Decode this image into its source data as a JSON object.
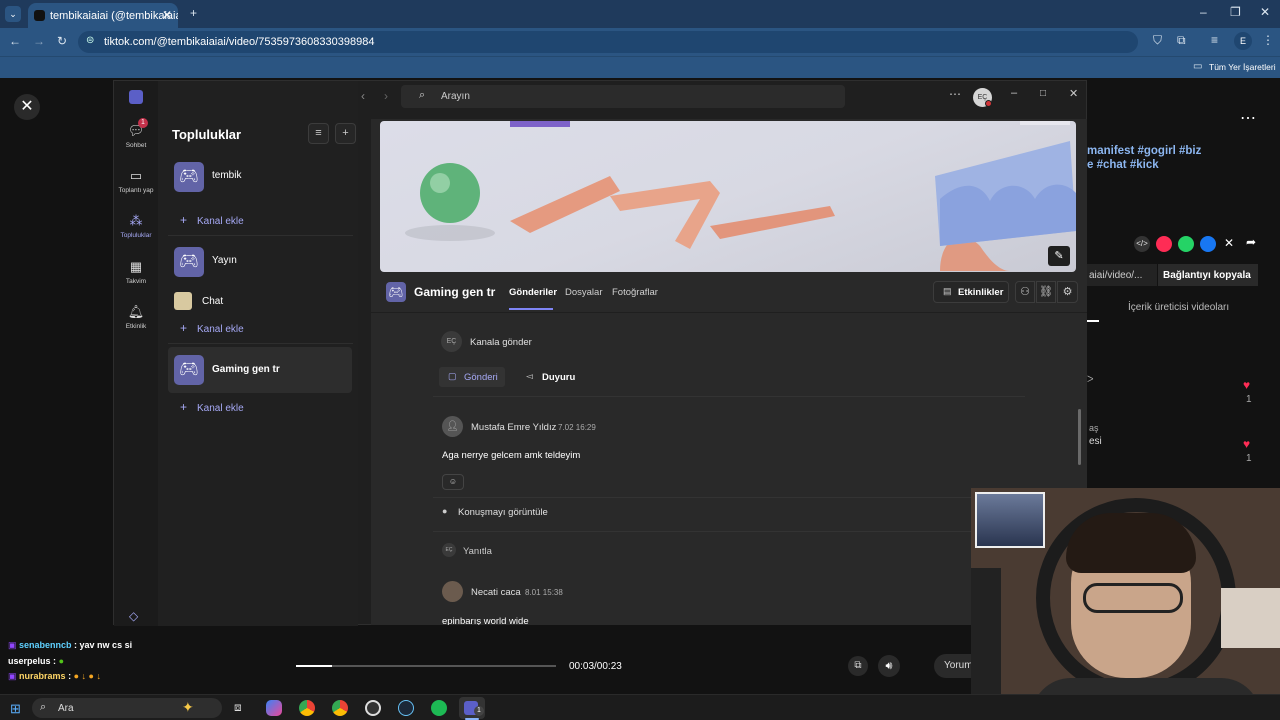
{
  "browser": {
    "tab_title": "tembikaiaiai (@tembikaiaiai) | T",
    "url": "tiktok.com/@tembikaiaiai/video/7535973608330398984",
    "profile_initial": "E",
    "bookmarks_label": "Tüm Yer İşaretleri"
  },
  "tiktok": {
    "hashtags_line1": "manifest #gogirl #biz",
    "hashtags_line2": "e #chat #kick",
    "link_partial": "aiai/video/...",
    "copy_link": "Bağlantıyı kopyala",
    "creator_videos": "İçerik üreticisi videoları",
    "comment_partial1": "aş",
    "comment_partial2": "esi",
    "like_count1": "1",
    "like_count2": "1",
    "time_display": "00:03/00:23",
    "progress": 0.14,
    "comment_button": "Yorum"
  },
  "stream_chat": [
    {
      "user": "senabenncb",
      "text": ": yav nw cs si"
    },
    {
      "user": "userpelus",
      "text": ":"
    },
    {
      "user": "nurabrams",
      "text": ":"
    }
  ],
  "taskbar": {
    "search_placeholder": "Ara",
    "teams_badge": "1"
  },
  "teams": {
    "search_placeholder": "Arayın",
    "avatar_initials": "EÇ",
    "rail": [
      {
        "label": "Sohbet",
        "badge": "1"
      },
      {
        "label": "Toplantı yap"
      },
      {
        "label": "Topluluklar"
      },
      {
        "label": "Takvim"
      },
      {
        "label": "Etkinlik"
      }
    ],
    "sidepane_title": "Topluluklar",
    "communities": [
      {
        "name": "tembik"
      },
      {
        "name": "Yayın"
      },
      {
        "name": "Chat"
      },
      {
        "name": "Gaming gen tr"
      }
    ],
    "add_channel": "Kanal ekle",
    "channel": {
      "name": "Gaming gen tr",
      "tabs": [
        "Gönderiler",
        "Dosyalar",
        "Fotoğraflar"
      ],
      "events_button": "Etkinlikler"
    },
    "compose": {
      "initials": "EÇ",
      "post_to_channel": "Kanala gönder",
      "post_tab": "Gönderi",
      "announcement_tab": "Duyuru"
    },
    "posts": [
      {
        "author": "Mustafa Emre Yıldız",
        "time": "7.02 16:29",
        "body": "Aga nerrye gelcem amk teldeyim",
        "view_conversation": "Konuşmayı görüntüle",
        "reply": "Yanıtla",
        "reply_initials": "EÇ"
      },
      {
        "author": "Necati caca",
        "time": "8.01 15:38",
        "body": "epinbarış world wide"
      }
    ]
  }
}
